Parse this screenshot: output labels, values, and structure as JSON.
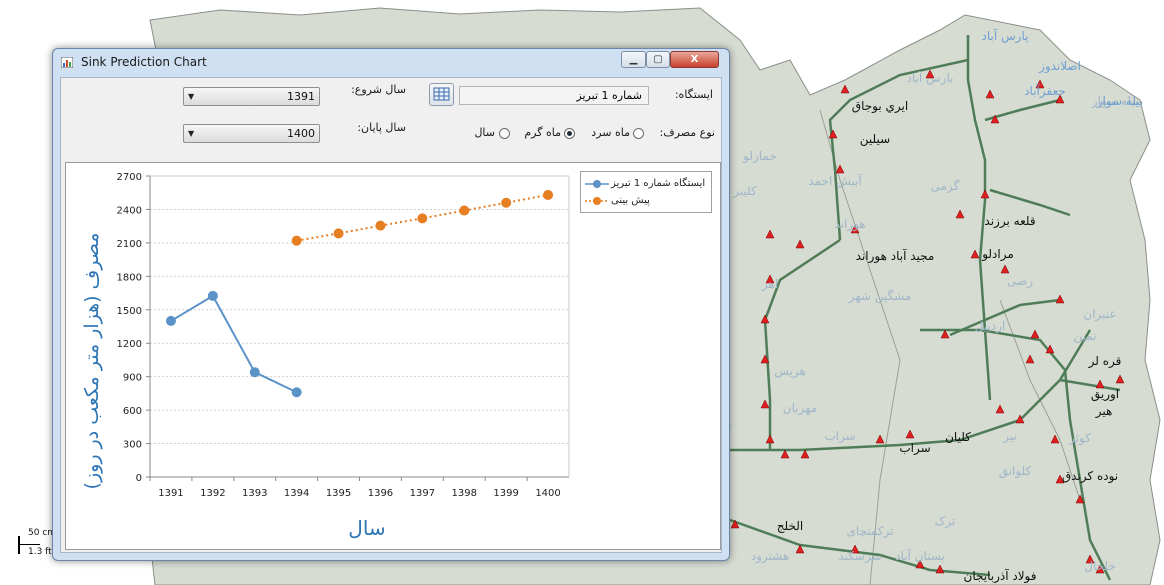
{
  "map": {
    "cities": [
      "پارس آباد",
      "اصلاندوز",
      "جعفرآباد",
      "بیله سوار",
      "ايري بوجاق",
      "سيلين",
      "قلعه برزند",
      "مجيد آباد هوراند",
      "مرادلو",
      "قره لر",
      "اوريق",
      "هير",
      "نوده كرندق",
      "كليان",
      "سراب",
      "الخلج",
      "فولاد آذربايجان"
    ],
    "faded_labels": [
      "بارس آباد",
      "بیله سوار",
      "خمارلو",
      "آبیش احمد",
      "کلیبر",
      "گرمی",
      "هوراند",
      "اهر",
      "مشگین شهر",
      "رضی",
      "اردبیل",
      "نمین",
      "عنبران",
      "هریس",
      "مهربان",
      "تبریز",
      "سراب",
      "نیر",
      "کوثر",
      "ترک",
      "ترکمنچای",
      "هشترود",
      "خلخال",
      "سرسکند",
      "بستان آباد",
      "کلوانق"
    ],
    "scale_top": "50 cm",
    "scale_bottom": "1.3 ft"
  },
  "window": {
    "title": "Sink Prediction Chart",
    "controls": {
      "minimize": "▁",
      "maximize": "▢",
      "close": "X"
    }
  },
  "form": {
    "station_label": "ایستگاه:",
    "station_value": "شماره 1 تبریز",
    "start_year_label": "سال شروع:",
    "start_year_value": "1391",
    "end_year_label": "سال پایان:",
    "end_year_value": "1400",
    "usage_label": "نوع مصرف:",
    "usage_options": [
      "ماه سرد",
      "ماه گرم",
      "سال"
    ],
    "usage_selected": "ماه گرم"
  },
  "chart_data": {
    "type": "line",
    "xlabel": "سال",
    "ylabel": "مصرف (هزار متر مکعب در روز)",
    "categories": [
      "1391",
      "1392",
      "1393",
      "1394",
      "1395",
      "1396",
      "1397",
      "1398",
      "1399",
      "1400"
    ],
    "ylim": [
      0,
      2700
    ],
    "yticks": [
      0,
      300,
      600,
      900,
      1200,
      1500,
      1800,
      2100,
      2400,
      2700
    ],
    "grid": "horizontal dashed",
    "legend_position": "top-right",
    "series": [
      {
        "name": "ایستگاه شماره 1 تبریز",
        "color": "#5b93c9",
        "style": "solid",
        "x": [
          "1391",
          "1392",
          "1393",
          "1394"
        ],
        "values": [
          1400,
          1625,
          940,
          760
        ]
      },
      {
        "name": "پیش بینی",
        "color": "#e67e22",
        "style": "dotted",
        "x": [
          "1394",
          "1395",
          "1396",
          "1397",
          "1398",
          "1399",
          "1400"
        ],
        "values": [
          2120,
          2185,
          2255,
          2320,
          2390,
          2460,
          2530
        ]
      }
    ]
  }
}
